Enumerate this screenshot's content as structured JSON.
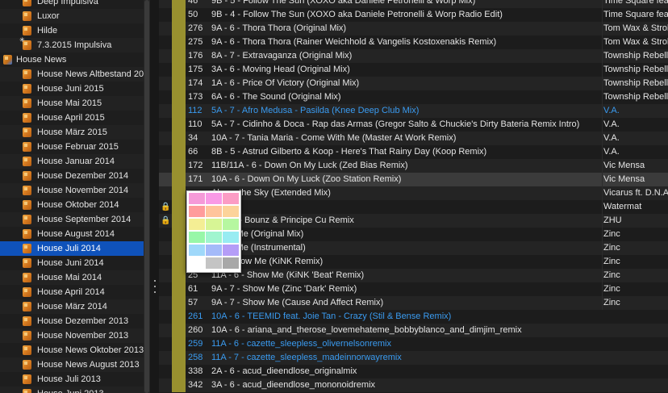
{
  "sidebar": {
    "items": [
      {
        "label": "Deep Impulsiva",
        "icon": "playlist-icon",
        "level": 1
      },
      {
        "label": "Luxor",
        "icon": "playlist-icon",
        "level": 1
      },
      {
        "label": "Hilde",
        "icon": "playlist-icon",
        "level": 1
      },
      {
        "label": "7.3.2015 Impulsiva",
        "icon": "smart-playlist-icon",
        "level": 1
      },
      {
        "label": "House News",
        "icon": "folder-icon",
        "level": 0
      },
      {
        "label": "House News Altbestand 2015",
        "icon": "playlist-icon",
        "level": 1
      },
      {
        "label": "House Juni 2015",
        "icon": "playlist-icon",
        "level": 1
      },
      {
        "label": "House Mai 2015",
        "icon": "playlist-icon",
        "level": 1
      },
      {
        "label": "House April 2015",
        "icon": "playlist-icon",
        "level": 1
      },
      {
        "label": "House März 2015",
        "icon": "playlist-icon",
        "level": 1
      },
      {
        "label": "House Februar 2015",
        "icon": "playlist-icon",
        "level": 1
      },
      {
        "label": "House Januar 2014",
        "icon": "playlist-icon",
        "level": 1
      },
      {
        "label": "House Dezember 2014",
        "icon": "playlist-icon",
        "level": 1
      },
      {
        "label": "House November 2014",
        "icon": "playlist-icon",
        "level": 1
      },
      {
        "label": "House Oktober 2014",
        "icon": "playlist-icon",
        "level": 1
      },
      {
        "label": "House September 2014",
        "icon": "playlist-icon",
        "level": 1
      },
      {
        "label": "House August 2014",
        "icon": "playlist-icon",
        "level": 1
      },
      {
        "label": "House Juli 2014",
        "icon": "playlist-icon",
        "level": 1,
        "selected": true
      },
      {
        "label": "House Juni 2014",
        "icon": "playlist-icon",
        "level": 1
      },
      {
        "label": "House Mai 2014",
        "icon": "playlist-icon",
        "level": 1
      },
      {
        "label": "House April 2014",
        "icon": "playlist-icon",
        "level": 1
      },
      {
        "label": "House März 2014",
        "icon": "playlist-icon",
        "level": 1
      },
      {
        "label": "House Dezember 2013",
        "icon": "playlist-icon",
        "level": 1
      },
      {
        "label": "House November 2013",
        "icon": "playlist-icon",
        "level": 1
      },
      {
        "label": "House News Oktober 2013",
        "icon": "playlist-icon",
        "level": 1
      },
      {
        "label": "House News August 2013",
        "icon": "playlist-icon",
        "level": 1
      },
      {
        "label": "House Juli 2013",
        "icon": "playlist-icon",
        "level": 1
      },
      {
        "label": "House Juni 2013",
        "icon": "playlist-icon",
        "level": 1
      }
    ]
  },
  "tracks": {
    "rows": [
      {
        "bpm": "46",
        "title": "9B - 5 - Follow The Sun (XOXO aka Daniele Petronelli & Worp Mix)",
        "artist": "Time Square feat",
        "color": "#98902f"
      },
      {
        "bpm": "50",
        "title": "9B - 4 - Follow The Sun (XOXO aka Daniele Petronelli & Worp Radio Edit)",
        "artist": "Time Square feat",
        "color": "#98902f"
      },
      {
        "bpm": "276",
        "title": "9A - 6 - Thora Thora (Original Mix)",
        "artist": "Tom Wax & Strob",
        "color": "#98902f"
      },
      {
        "bpm": "275",
        "title": "9A - 6 - Thora Thora (Rainer Weichhold & Vangelis Kostoxenakis Remix)",
        "artist": "Tom Wax & Strob",
        "color": "#98902f"
      },
      {
        "bpm": "176",
        "title": "8A - 7 - Extravaganza (Original Mix)",
        "artist": "Township Rebelli",
        "color": "#98902f"
      },
      {
        "bpm": "175",
        "title": "3A - 6 - Moving Head (Original Mix)",
        "artist": "Township Rebelli",
        "color": "#98902f"
      },
      {
        "bpm": "174",
        "title": "1A - 6 - Price Of Victory (Original Mix)",
        "artist": "Township Rebelli",
        "color": "#98902f"
      },
      {
        "bpm": "173",
        "title": "6A - 6 - The Sound (Original Mix)",
        "artist": "Township Rebelli",
        "color": "#98902f"
      },
      {
        "bpm": "112",
        "title": "5A - 7 - Afro Medusa - Pasilda (Knee Deep Club Mix)",
        "artist": "V.A.",
        "color": "#98902f",
        "blue": true
      },
      {
        "bpm": "110",
        "title": "5A - 7 - Cidinho & Doca - Rap das Armas (Gregor Salto & Chuckie's Dirty Bateria Remix Intro)",
        "artist": "V.A.",
        "color": "#98902f"
      },
      {
        "bpm": "34",
        "title": "10A - 7 - Tania Maria - Come With Me (Master At Work Remix)",
        "artist": "V.A.",
        "color": "#98902f"
      },
      {
        "bpm": "66",
        "title": "8B - 5 - Astrud Gilberto & Koop - Here's That Rainy Day (Koop Remix)",
        "artist": "V.A.",
        "color": "#98902f"
      },
      {
        "bpm": "172",
        "title": "11B/11A - 6 - Down On My Luck (Zed Bias Remix)",
        "artist": "Vic Mensa",
        "color": "#98902f"
      },
      {
        "bpm": "171",
        "title": "10A - 6 - Down On My Luck (Zoo Station Remix)",
        "artist": "Vic Mensa",
        "color": "#98902f",
        "highlight": true
      },
      {
        "bpm": "",
        "title": "Above the Sky (Extended Mix)",
        "artist": "Vicarus ft. D.N.A.",
        "color": "#98902f"
      },
      {
        "bpm": "",
        "title": "Bullit",
        "artist": "Watermat",
        "color": "#98902f",
        "lock": true
      },
      {
        "bpm": "",
        "title": "Faded - Bounz & Principe Cu Remix",
        "artist": "ZHU",
        "color": "#98902f",
        "lock": true
      },
      {
        "bpm": "",
        "title": "Show Me (Original Mix)",
        "artist": "Zinc",
        "color": "#98902f"
      },
      {
        "bpm": "",
        "title": "Show Me (Instrumental)",
        "artist": "Zinc",
        "color": "#98902f"
      },
      {
        "bpm": "",
        "title": "- 6 - Show Me (KiNK Remix)",
        "artist": "Zinc",
        "color": "#98902f"
      },
      {
        "bpm": "25",
        "title": "11A - 6 - Show Me (KiNK 'Beat' Remix)",
        "artist": "Zinc",
        "color": "#98902f"
      },
      {
        "bpm": "61",
        "title": "9A - 7 - Show Me (Zinc 'Dark' Remix)",
        "artist": "Zinc",
        "color": "#98902f"
      },
      {
        "bpm": "57",
        "title": "9A - 7 - Show Me (Cause And Affect Remix)",
        "artist": "Zinc",
        "color": "#98902f"
      },
      {
        "bpm": "261",
        "title": "10A - 6 - TEEMID feat. Joie Tan - Crazy (Stil & Bense Remix)",
        "artist": "",
        "color": "#98902f",
        "blue": true
      },
      {
        "bpm": "260",
        "title": "10A - 6 - ariana_and_therose_lovemehateme_bobbyblanco_and_dimjim_remix",
        "artist": "",
        "color": "#98902f"
      },
      {
        "bpm": "259",
        "title": "11A - 6 - cazette_sleepless_olivernelsonremix",
        "artist": "",
        "color": "#98902f",
        "blue": true
      },
      {
        "bpm": "258",
        "title": "11A - 7 - cazette_sleepless_madeinnorwayremix",
        "artist": "",
        "color": "#98902f",
        "blue": true
      },
      {
        "bpm": "338",
        "title": "2A - 6 - acud_dieendlose_originalmix",
        "artist": "",
        "color": "#98902f"
      },
      {
        "bpm": "342",
        "title": "3A - 6 - acud_dieendlose_mononoidremix",
        "artist": "",
        "color": "#98902f"
      }
    ]
  },
  "palette": {
    "swatches": [
      "#f59ad8",
      "#f99ae6",
      "#fb9cc4",
      "#ff9c9c",
      "#ffc49c",
      "#fcd39a",
      "#f4ee94",
      "#d7f595",
      "#b6f7a0",
      "#98f7a8",
      "#a0f5cf",
      "#98ecf2",
      "#9fd8fa",
      "#a4baf9",
      "#b59df7",
      "#ffffff",
      "#c4c4c4",
      "#a8a8a8"
    ]
  },
  "colors": {
    "selection": "#0f52ba",
    "blue_text": "#3a9bf0",
    "color_tag": "#98902f"
  }
}
